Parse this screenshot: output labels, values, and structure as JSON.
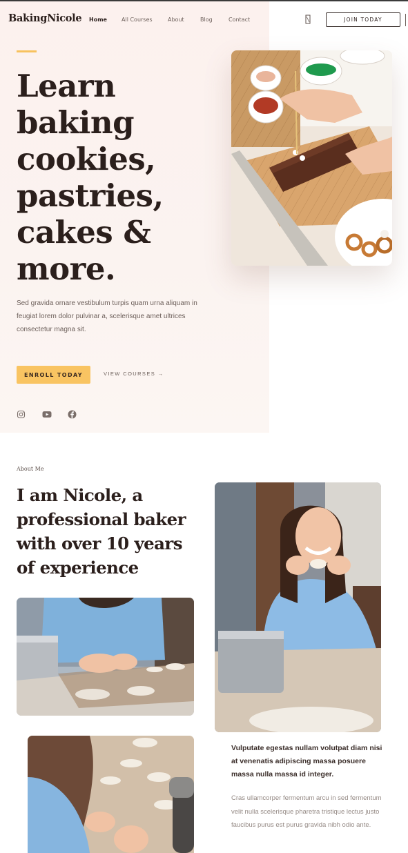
{
  "header": {
    "logo": "BakingNicole",
    "nav": [
      "Home",
      "All Courses",
      "About",
      "Blog",
      "Contact"
    ],
    "active_nav": "Home",
    "search_icon": "search-icon",
    "join_label": "JOIN TODAY"
  },
  "hero": {
    "title_lines": [
      "Learn",
      "baking",
      "cookies,",
      "pastries,",
      "cakes &",
      "more."
    ],
    "description": "Sed gravida ornare vestibulum turpis quam urna aliquam in feugiat lorem dolor pulvinar a, scelerisque amet ultrices consectetur magna sit.",
    "enroll_label": "ENROLL TODAY",
    "view_label": "VIEW COURSES →",
    "social": [
      "instagram-icon",
      "youtube-icon",
      "facebook-icon"
    ]
  },
  "about": {
    "eyebrow": "About Me",
    "title_lines": [
      "I am Nicole, a",
      "professional baker",
      "with over 10 years",
      "of experience"
    ],
    "lead": "Vulputate egestas nullam volutpat diam nisi at venenatis adipiscing massa posuere massa nulla massa id integer.",
    "body": "Cras ullamcorper fermentum arcu in sed fermentum velit nulla scelerisque pharetra tristique lectus justo faucibus purus est purus gravida nibh odio ante."
  },
  "colors": {
    "accent": "#f9c462",
    "hero_bg": "#fcf1ee",
    "text_dark": "#2b1f1c"
  }
}
